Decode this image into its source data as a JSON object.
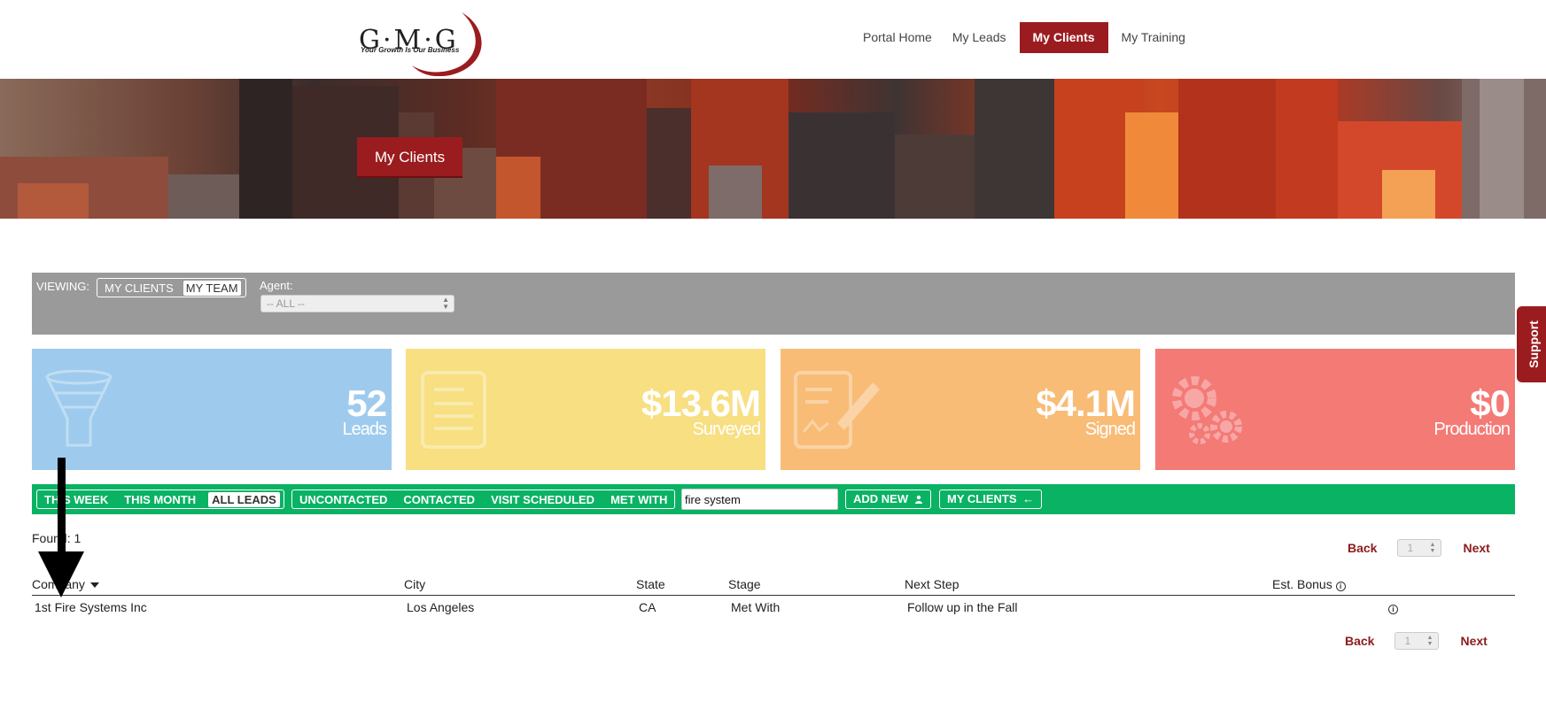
{
  "header": {
    "logo_letters": "G·M·G",
    "logo_tagline": "Your Growth Is Our Business",
    "nav": [
      "Portal Home",
      "My Leads",
      "My Clients",
      "My Training"
    ],
    "active_nav": "My Clients"
  },
  "banner": {
    "title": "My Clients"
  },
  "viewing": {
    "label": "VIEWING:",
    "options": [
      "MY CLIENTS",
      "MY TEAM"
    ],
    "selected": "MY TEAM",
    "agent_label": "Agent:",
    "agent_value": "-- ALL --"
  },
  "stats": [
    {
      "value": "52",
      "label": "Leads",
      "color": "#9ecbed",
      "icon": "funnel-icon"
    },
    {
      "value": "$13.6M",
      "label": "Surveyed",
      "color": "#f7df82",
      "icon": "document-icon"
    },
    {
      "value": "$4.1M",
      "label": "Signed",
      "color": "#f8bc76",
      "icon": "signed-document-icon"
    },
    {
      "value": "$0",
      "label": "Production",
      "color": "#f47a76",
      "icon": "gears-icon"
    }
  ],
  "filters": {
    "time": [
      "THIS WEEK",
      "THIS MONTH",
      "ALL LEADS"
    ],
    "time_selected": "ALL LEADS",
    "status": [
      "UNCONTACTED",
      "CONTACTED",
      "VISIT SCHEDULED",
      "MET WITH"
    ],
    "search_value": "fire system",
    "add_new": "ADD NEW",
    "my_clients": "MY CLIENTS"
  },
  "results": {
    "found": "Found: 1",
    "pager": {
      "back": "Back",
      "page": "1",
      "next": "Next"
    },
    "columns": [
      "Company",
      "City",
      "State",
      "Stage",
      "Next Step",
      "Est. Bonus"
    ],
    "rows": [
      {
        "company": "1st Fire Systems Inc",
        "city": "Los Angeles",
        "state": "CA",
        "stage": "Met With",
        "next_step": "Follow up in the Fall"
      }
    ]
  },
  "support": "Support",
  "colors": {
    "brand": "#9b1c1f",
    "filter_green": "#0ab264",
    "view_gray": "#9a9a9a"
  }
}
